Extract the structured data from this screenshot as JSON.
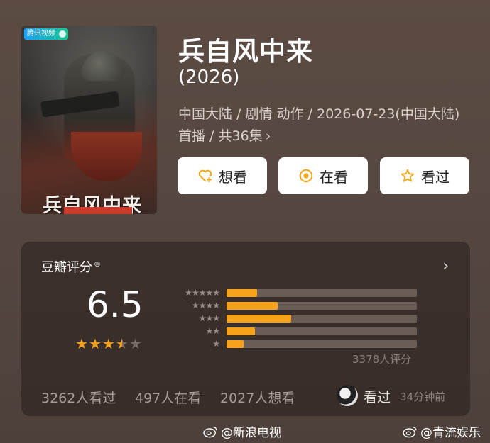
{
  "poster": {
    "platform_badge": "腾讯视频",
    "title_art": "兵自风中来"
  },
  "header": {
    "title": "兵自风中来",
    "year": "(2026)",
    "meta_line": "中国大陆 / 剧情 动作 / 2026-07-23(中国大陆)首播 / 共36集",
    "meta_arrow": "›"
  },
  "actions": {
    "want_label": "想看",
    "watching_label": "在看",
    "watched_label": "看过"
  },
  "rating": {
    "source_label": "豆瓣评分",
    "registered_mark": "®",
    "score": "6.5",
    "stars_value": 3.5,
    "stars_max": 5,
    "distribution": [
      {
        "stars": 5,
        "fraction": 0.16
      },
      {
        "stars": 4,
        "fraction": 0.27
      },
      {
        "stars": 3,
        "fraction": 0.34
      },
      {
        "stars": 2,
        "fraction": 0.15
      },
      {
        "stars": 1,
        "fraction": 0.09
      }
    ],
    "count_text": "3378人评分",
    "watched_count": "3262人看过",
    "watching_count": "497人在看",
    "want_count": "2027人想看",
    "my_status": "看过",
    "my_status_time": "34分钟前"
  },
  "watermarks": {
    "left": "@新浪电视",
    "right": "@青流娱乐"
  },
  "colors": {
    "accent": "#f7a21b",
    "button_icon": "#f0a81a",
    "star_empty": "#7a6d66"
  }
}
